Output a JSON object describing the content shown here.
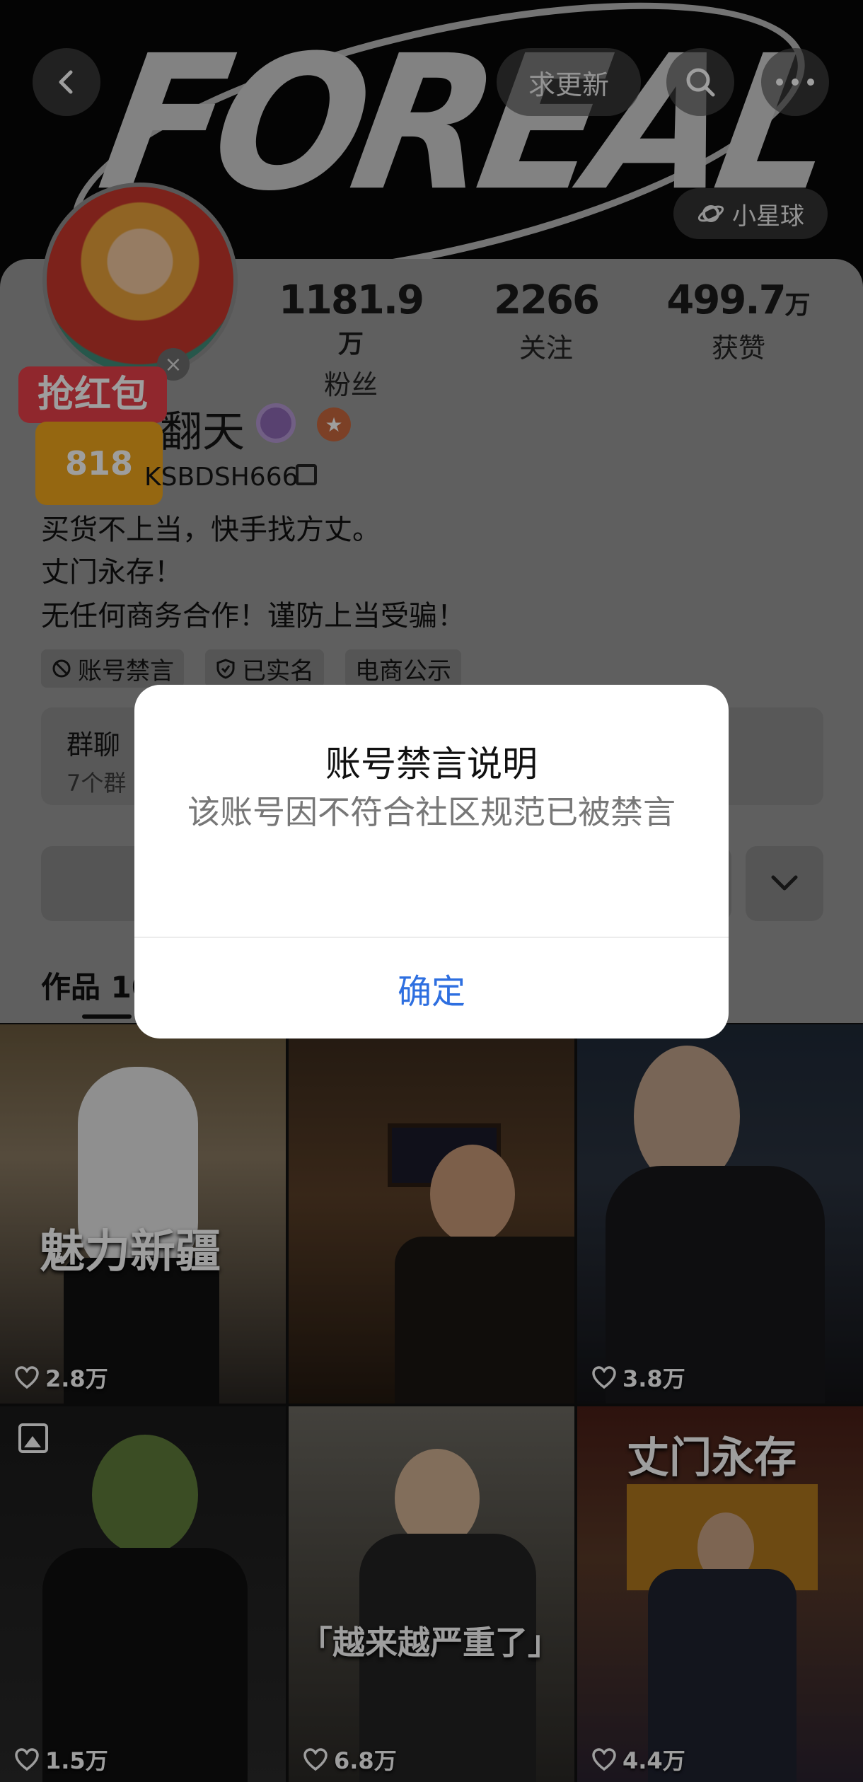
{
  "header": {
    "banner_text": "FOREAL",
    "update_button": "求更新",
    "planet_label": "小星球"
  },
  "profile": {
    "name_suffix": "翻天",
    "handle": "KSBDSH666",
    "bio": [
      "买货不上当，快手找方丈。",
      "丈门永存！",
      "无任何商务合作！谨防上当受骗！"
    ],
    "red_packet": {
      "title": "抢红包",
      "badge": "818"
    },
    "stats": [
      {
        "value": "1181.9",
        "unit": "万",
        "label": "粉丝"
      },
      {
        "value": "2266",
        "unit": "",
        "label": "关注"
      },
      {
        "value": "499.7",
        "unit": "万",
        "label": "获赞"
      }
    ],
    "tags": [
      "账号禁言",
      "已实名",
      "电商公示"
    ],
    "group": {
      "title": "群聊",
      "subtitle": "7个群"
    },
    "works_tab": "作品 10"
  },
  "grid": [
    {
      "overlay": "魅力新疆",
      "likes": "2.8万"
    },
    {
      "overlay": "",
      "likes": ""
    },
    {
      "overlay": "",
      "likes": "3.8万"
    },
    {
      "overlay": "",
      "likes": "1.5万"
    },
    {
      "overlay": "「越来越严重了」",
      "likes": "6.8万"
    },
    {
      "overlay": "丈门永存",
      "likes": "4.4万"
    }
  ],
  "dialog": {
    "title": "账号禁言说明",
    "message": "该账号因不符合社区规范已被禁言",
    "confirm": "确定"
  },
  "colors": {
    "dialog_button": "#2e6fe0",
    "overlay_dim": "rgba(0,0,0,0.38)"
  }
}
